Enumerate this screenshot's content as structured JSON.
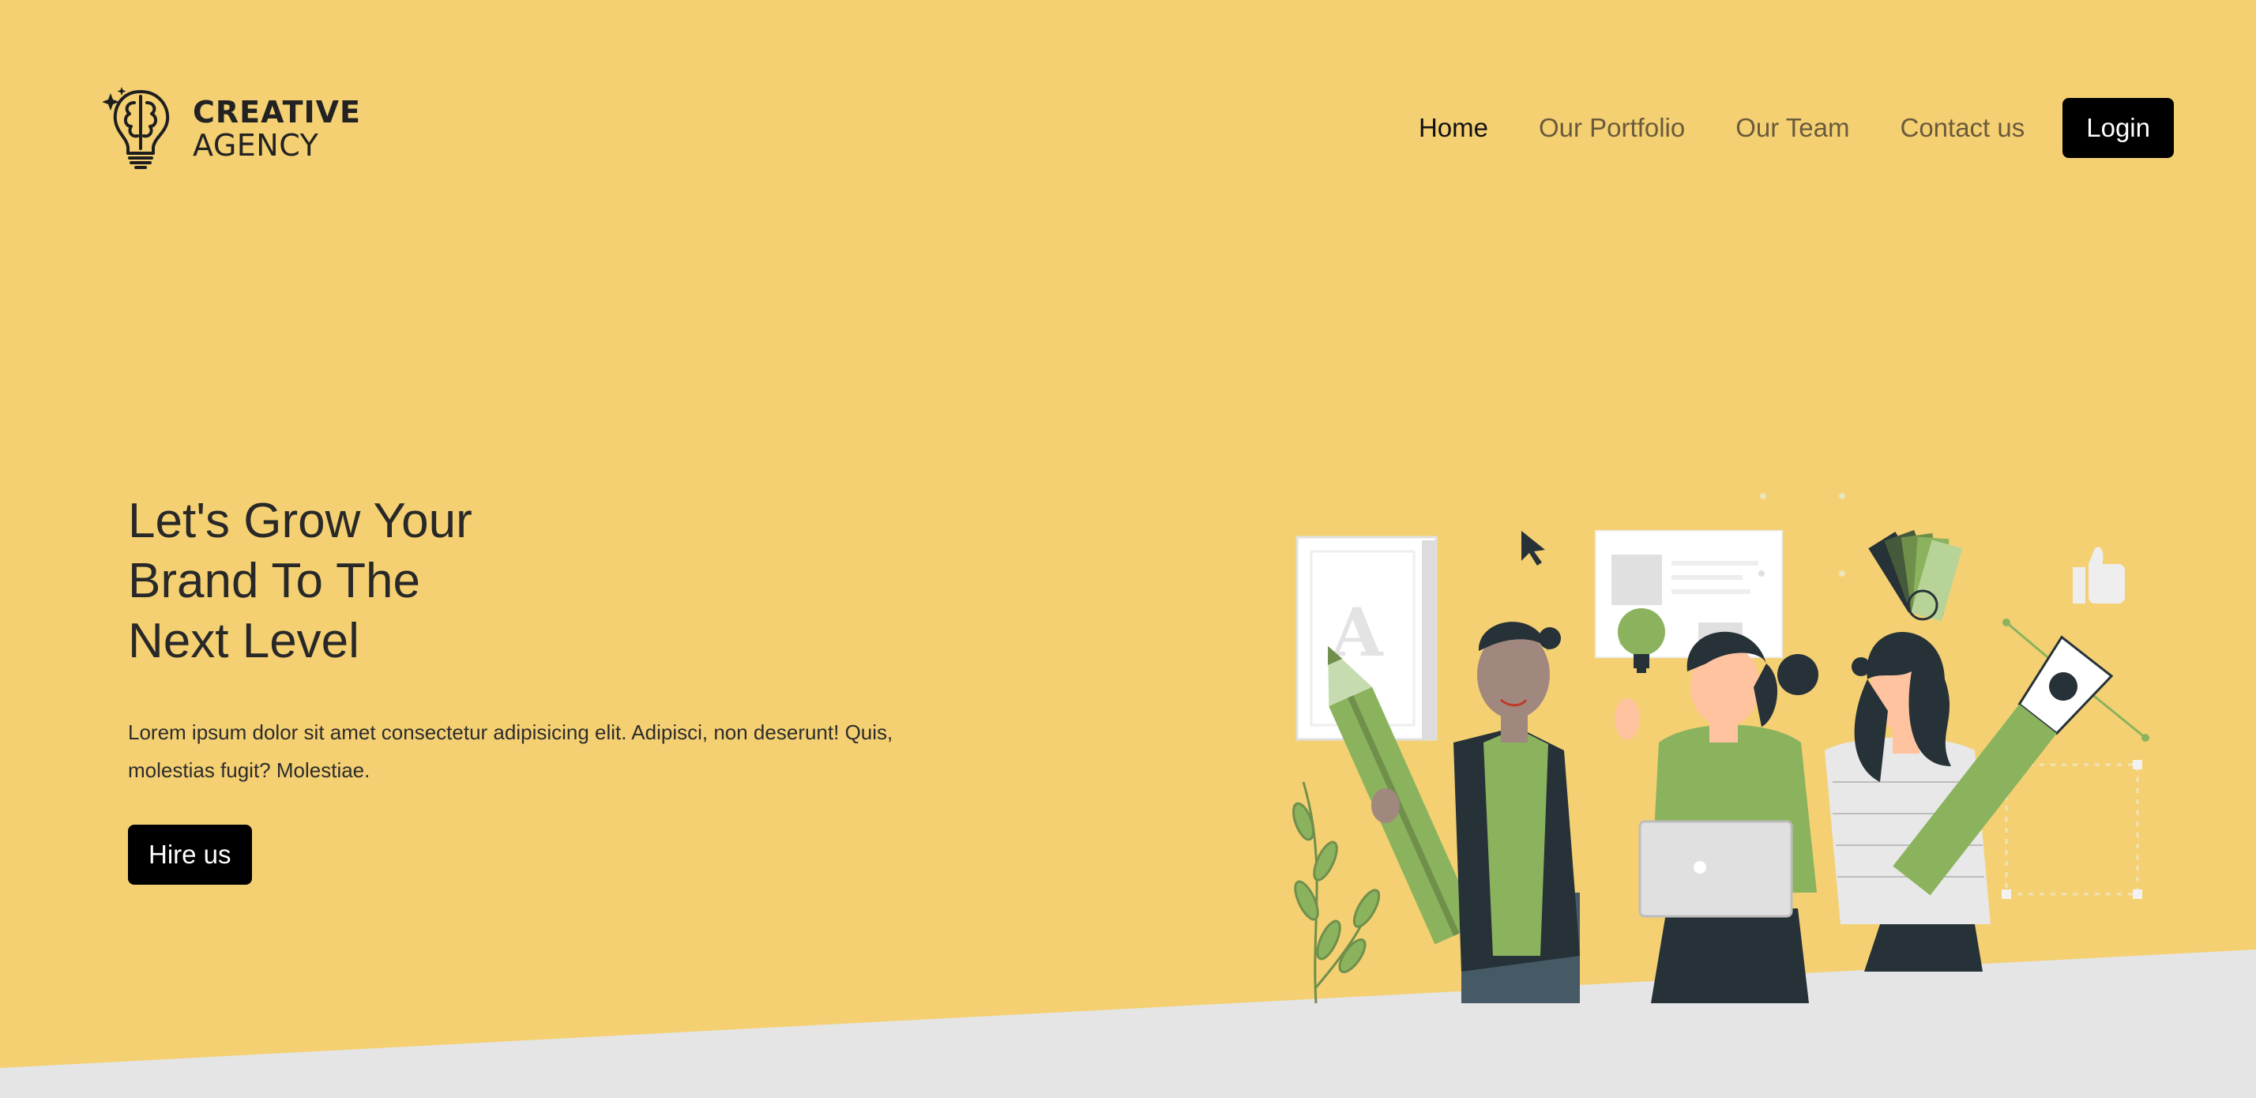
{
  "brand": {
    "title": "CREATIVE",
    "subtitle": "AGENCY",
    "icon": "brain-lightbulb-icon"
  },
  "nav": {
    "items": [
      {
        "label": "Home",
        "active": true
      },
      {
        "label": "Our Portfolio",
        "active": false
      },
      {
        "label": "Our Team",
        "active": false
      },
      {
        "label": "Contact us",
        "active": false
      }
    ],
    "login_label": "Login"
  },
  "hero": {
    "title_lines": [
      "Let's Grow Your",
      "Brand To The",
      "Next Level"
    ],
    "description": "Lorem ipsum dolor sit amet consectetur adipisicing elit. Adipisci, non deserunt! Quis, molestias fugit? Molestiae.",
    "cta_label": "Hire us",
    "illustration": "team-creative-illustration",
    "illustration_glyph": "A"
  },
  "colors": {
    "background": "#f4d072",
    "bottom_band": "#e5e5e5",
    "accent_green": "#8bb35e",
    "dark": "#263238",
    "button": "#000000"
  }
}
